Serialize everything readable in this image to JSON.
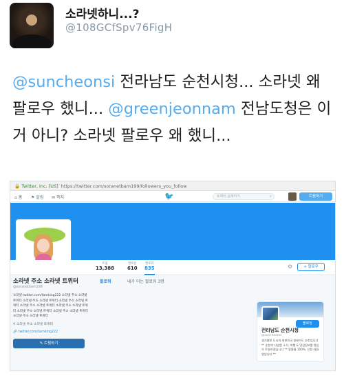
{
  "tweet": {
    "display_name": "소라넷하니...?",
    "handle": "@108GCfSpv76FigH",
    "mention1": "@suncheonsi",
    "text1": " 전라남도 순천시청... 소라넷 왜 팔로우 했니... ",
    "mention2": "@greenjeonnam",
    "text2": " 전남도청은 이거 아니? 소라넷 팔로우 왜 했니..."
  },
  "screenshot": {
    "browser": {
      "secure_label": "Twitter, Inc. [US]",
      "url": "https://twitter.com/soranetbam199/followers_you_follow"
    },
    "topnav": {
      "home": "홈",
      "notifications": "알림",
      "messages": "쪽지",
      "search_placeholder": "트위터 검색하기",
      "tweet_button": "트윗하기"
    },
    "stats": [
      {
        "label": "트윗",
        "value": "13,388"
      },
      {
        "label": "팔로잉",
        "value": "610"
      },
      {
        "label": "팔로워",
        "value": "835"
      }
    ],
    "follow_button": "팔로우",
    "profile": {
      "name": "소라넷 주소 소라넷 트위터",
      "handle": "@soranetbam199",
      "bio": "소라넷 twitter.com/tamking222 소라넷 주소 소라넷 트위터 소라넷 주소 소라넷 트위터 소라넷 주소 소라넷 트위터 소라넷 주소 소라넷 트위터 소라넷 주소 소라넷 트위터 소라넷 주소 소라넷 트위터 소라넷 주소 소라넷 트위터 소라넷 주소 소라넷 트위터",
      "location": "소라넷 주소 소라넷 트위터",
      "url": "twitter.com/tamking222",
      "tweet_to_button": "트윗하기"
    },
    "tabs": {
      "followers": "팔로워",
      "followers_you_know": "내가 아는 팔로워 3명"
    },
    "suggestion": {
      "name": "전라남도 순천시청",
      "handle": "@suncheonsi",
      "follow_button": "팔로잉",
      "bio": "생기충천 도시의 대한민국 생태수도 순천입니다 ** 순천의 다양한 소식, 여행 & 맛집정보를 열심히 트윗하겠습니다 ** 맞팔율 100%, 신청 대환영입니다 **"
    }
  }
}
